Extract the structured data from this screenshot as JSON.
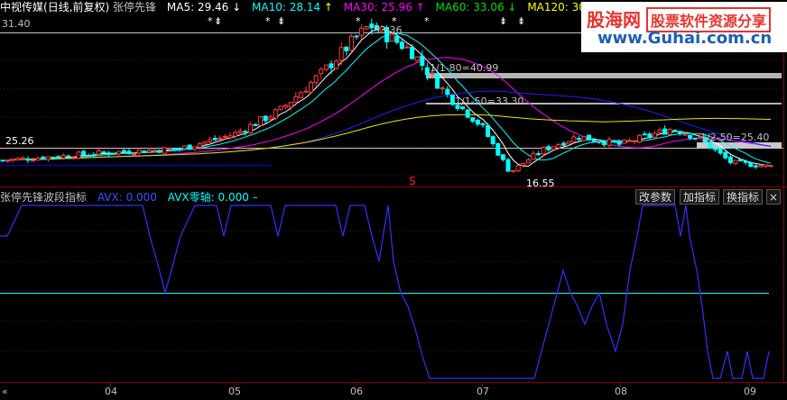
{
  "header": {
    "stock": "中视传媒",
    "mode": "(日线,前复权)",
    "indicator_name": "张停先锋",
    "ma": [
      {
        "label": "MA5: 29.46",
        "arrow": "↓",
        "color": "#ffffff"
      },
      {
        "label": "MA10: 28.14",
        "arrow": "↑",
        "color": "#ffff00"
      },
      {
        "label": "MA30: 25.96",
        "arrow": "↑",
        "color": "#ff00ff"
      },
      {
        "label": "MA60: 33.06",
        "arrow": "↓",
        "color": "#00c000"
      },
      {
        "label": "MA120: 30.35",
        "arrow": "↑",
        "color": "#ffff00"
      }
    ]
  },
  "price_labels": {
    "top_clipped": "31.40",
    "left_level": "25.26",
    "peak": "53.36",
    "low": "16.55",
    "level1": "1/1-80=40.99",
    "level2": "1/1-50=33.30",
    "level3": "1/2-50=25.40",
    "signal": "S"
  },
  "indicator_panel": {
    "title": "张停先锋波段指标",
    "avx_label": "AVX: 0.000",
    "zero_label": "AVX零轴: 0.000",
    "dash": "–",
    "buttons": [
      "改参数",
      "加指标",
      "换指标"
    ],
    "close": "×"
  },
  "x_axis": {
    "labels": [
      "04",
      "05",
      "06",
      "07",
      "08",
      "09"
    ]
  },
  "watermark": {
    "brand": "股海网",
    "slogan": "股票软件资源分享",
    "url": "www.Guhai.com.cn"
  },
  "colors": {
    "up": "#ff3c3c",
    "down": "#00ffff",
    "ma5": "#ffffff",
    "ma10": "#ffff00",
    "ma30": "#ff00ff",
    "ma60": "#0000ff",
    "ma120": "#ffff00",
    "cyan_line": "#00ffff",
    "indicator": "#3232ff",
    "grid": "#8b0000"
  },
  "chart_data": [
    {
      "type": "candlestick",
      "ylim": [
        13,
        56
      ],
      "x": [
        "04",
        "05",
        "06",
        "07",
        "08",
        "09"
      ],
      "close_trend": [
        {
          "x": "03-start",
          "y": 19.5
        },
        {
          "x": "04",
          "y": 21.5
        },
        {
          "x": "04-late",
          "y": 22.5
        },
        {
          "x": "05",
          "y": 26.0
        },
        {
          "x": "05-mid",
          "y": 32.0
        },
        {
          "x": "05-late",
          "y": 41.0
        },
        {
          "x": "06",
          "y": 50.0
        },
        {
          "x": "06-peak",
          "y": 53.36
        },
        {
          "x": "06-mid",
          "y": 47.0
        },
        {
          "x": "06-late",
          "y": 36.0
        },
        {
          "x": "07",
          "y": 28.0
        },
        {
          "x": "07-low",
          "y": 16.55
        },
        {
          "x": "07-late",
          "y": 22.0
        },
        {
          "x": "08-early",
          "y": 25.5
        },
        {
          "x": "08",
          "y": 23.5
        },
        {
          "x": "08-late",
          "y": 27.5
        },
        {
          "x": "08-end",
          "y": 25.0
        },
        {
          "x": "09",
          "y": 19.0
        },
        {
          "x": "09-end",
          "y": 18.0
        }
      ]
    },
    {
      "type": "line",
      "series": [
        {
          "name": "AVX",
          "values": [
            0.0
          ]
        }
      ],
      "ylim": [
        0,
        1
      ],
      "zero_line": 0.0
    }
  ]
}
